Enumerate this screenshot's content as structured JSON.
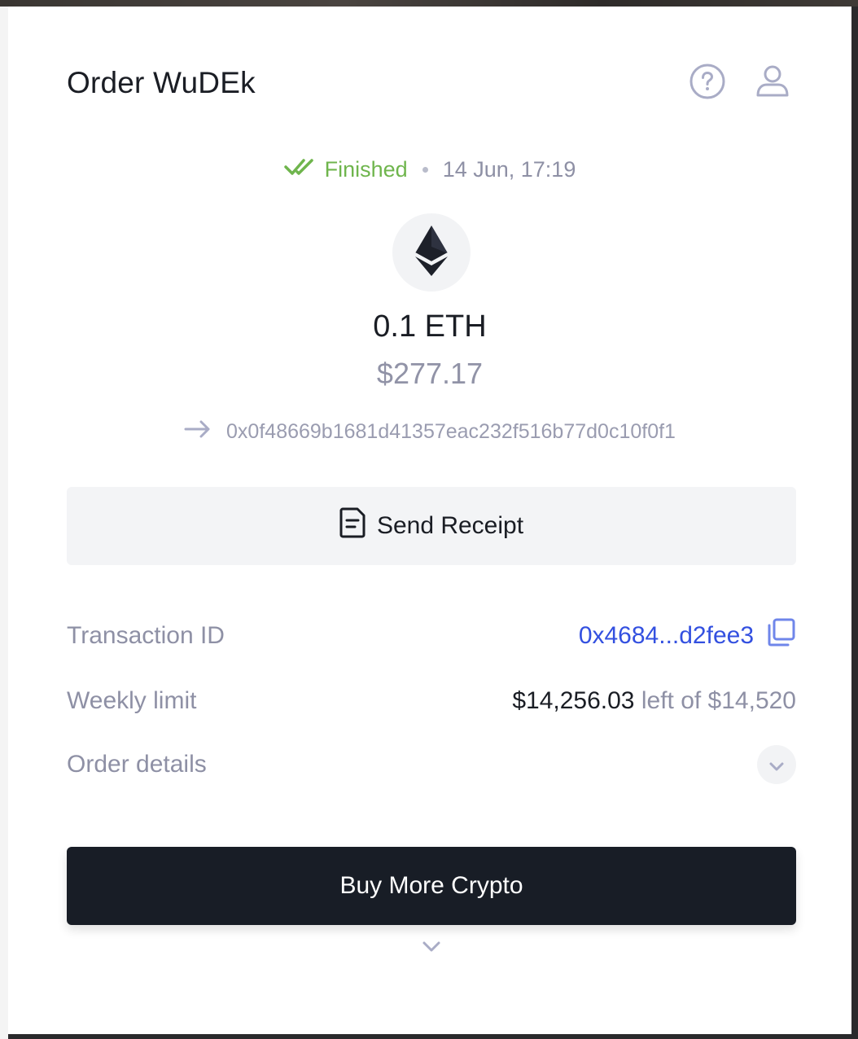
{
  "header": {
    "title": "Order WuDEk",
    "help_icon": "help-circle-icon",
    "profile_icon": "user-icon"
  },
  "status": {
    "label": "Finished",
    "timestamp": "14 Jun, 17:19",
    "color": "#6fb54d"
  },
  "asset": {
    "icon": "ethereum-icon",
    "amount": "0.1 ETH",
    "fiat_value": "$277.17",
    "destination_address": "0x0f48669b1681d41357eac232f516b77d0c10f0f1"
  },
  "receipt_button": {
    "label": "Send Receipt",
    "icon": "document-icon"
  },
  "details": {
    "transaction_id_label": "Transaction ID",
    "transaction_id_value": "0x4684...d2fee3",
    "weekly_limit_label": "Weekly limit",
    "weekly_limit_remaining": "$14,256.03",
    "weekly_limit_suffix": "left of $14,520",
    "order_details_label": "Order details"
  },
  "actions": {
    "buy_more_label": "Buy More Crypto"
  },
  "colors": {
    "accent_link": "#3350e0",
    "primary_button": "#181d26",
    "muted_text": "#8e90a5"
  }
}
